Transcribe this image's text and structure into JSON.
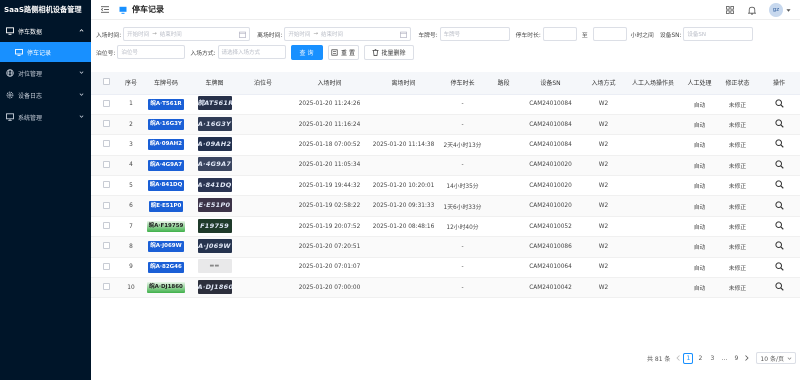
{
  "sidebar": {
    "brand": "SaaS路侧相机设备管理",
    "groups": [
      {
        "label": "停车数据",
        "icon": "monitor-icon",
        "open": true
      },
      {
        "label": "对位管理",
        "icon": "globe-icon"
      },
      {
        "label": "设备日志",
        "icon": "settings-icon"
      },
      {
        "label": "系统管理",
        "icon": "computer-icon"
      }
    ],
    "active_item": {
      "label": "停车记录",
      "icon": "monitor-icon"
    }
  },
  "header": {
    "title": "停车记录",
    "avatar_text": "gz"
  },
  "filters": {
    "entry_time_label": "入场时间:",
    "exit_time_label": "离场时间:",
    "start_placeholder": "开始时间",
    "end_placeholder": "结束时间",
    "plate_label": "车牌号:",
    "plate_placeholder": "车牌号",
    "duration_label": "停车时长:",
    "duration_to": "至",
    "duration_unit": "小时之间",
    "sn_label": "设备SN:",
    "sn_placeholder": "设备SN",
    "berth_label": "泊位号:",
    "berth_placeholder": "泊位号",
    "entry_mode_label": "入场方式:",
    "entry_mode_placeholder": "请选择入场方式",
    "search_button": "查 询",
    "reset_button": "重 置",
    "batch_delete_button": "批量删除"
  },
  "table": {
    "columns": [
      "序号",
      "车牌号码",
      "车牌图",
      "泊位号",
      "入场时间",
      "离场时间",
      "停车时长",
      "路段",
      "设备SN",
      "入场方式",
      "人工入场操作员",
      "人工处理",
      "修正状态",
      "操作"
    ],
    "rows": [
      {
        "no": "1",
        "plate": "皖A·T561R",
        "plate_color": "blue",
        "img_text": "皖AT561R",
        "berth": "",
        "entry": "2025-01-20 11:24:26",
        "exit": "",
        "duration": "-",
        "road": "",
        "sn": "CAM24010084",
        "mode": "W2",
        "operator": "",
        "manual": "自动",
        "fix": "未修正"
      },
      {
        "no": "2",
        "plate": "皖A·16G3Y",
        "plate_color": "blue",
        "img_text": "A·16G3Y",
        "berth": "",
        "entry": "2025-01-20 11:16:24",
        "exit": "",
        "duration": "-",
        "road": "",
        "sn": "CAM24010084",
        "mode": "W2",
        "operator": "",
        "manual": "自动",
        "fix": "未修正"
      },
      {
        "no": "3",
        "plate": "皖A·09AH2",
        "plate_color": "blue",
        "img_text": "A·09AH2",
        "berth": "",
        "entry": "2025-01-18 07:00:52",
        "exit": "2025-01-20 11:14:38",
        "duration": "2天4小时13分",
        "road": "",
        "sn": "CAM24010084",
        "mode": "W2",
        "operator": "",
        "manual": "自动",
        "fix": "未修正"
      },
      {
        "no": "4",
        "plate": "皖A·4G9A7",
        "plate_color": "blue",
        "img_text": "A·4G9A7",
        "berth": "",
        "entry": "2025-01-20 11:05:34",
        "exit": "",
        "duration": "-",
        "road": "",
        "sn": "CAM24010020",
        "mode": "W2",
        "operator": "",
        "manual": "自动",
        "fix": "未修正"
      },
      {
        "no": "5",
        "plate": "皖A·841DQ",
        "plate_color": "blue",
        "img_text": "A·841DQ",
        "berth": "",
        "entry": "2025-01-19 19:44:32",
        "exit": "2025-01-20 10:20:01",
        "duration": "14小时35分",
        "road": "",
        "sn": "CAM24010020",
        "mode": "W2",
        "operator": "",
        "manual": "自动",
        "fix": "未修正"
      },
      {
        "no": "6",
        "plate": "皖E·E51P0",
        "plate_color": "blue",
        "img_text": "E·E51P0",
        "berth": "",
        "entry": "2025-01-19 02:58:22",
        "exit": "2025-01-20 09:31:33",
        "duration": "1天6小时33分",
        "road": "",
        "sn": "CAM24010020",
        "mode": "W2",
        "operator": "",
        "manual": "自动",
        "fix": "未修正"
      },
      {
        "no": "7",
        "plate": "皖A·F19759",
        "plate_color": "green",
        "img_text": "F19759",
        "berth": "",
        "entry": "2025-01-19 20:07:52",
        "exit": "2025-01-20 08:48:16",
        "duration": "12小时40分",
        "road": "",
        "sn": "CAM24010052",
        "mode": "W2",
        "operator": "",
        "manual": "自动",
        "fix": "未修正"
      },
      {
        "no": "8",
        "plate": "皖A·J069W",
        "plate_color": "blue",
        "img_text": "A·J069W",
        "berth": "",
        "entry": "2025-01-20 07:20:51",
        "exit": "",
        "duration": "-",
        "road": "",
        "sn": "CAM24010086",
        "mode": "W2",
        "operator": "",
        "manual": "自动",
        "fix": "未修正"
      },
      {
        "no": "9",
        "plate": "皖A·82G46",
        "plate_color": "blue",
        "img_text": "▬▬",
        "berth": "",
        "entry": "2025-01-20 07:01:07",
        "exit": "",
        "duration": "-",
        "road": "",
        "sn": "CAM24010064",
        "mode": "W2",
        "operator": "",
        "manual": "自动",
        "fix": "未修正"
      },
      {
        "no": "10",
        "plate": "皖A·DJ1860",
        "plate_color": "green",
        "img_text": "A·DJ1860",
        "berth": "",
        "entry": "2025-01-20 07:00:00",
        "exit": "",
        "duration": "-",
        "road": "",
        "sn": "CAM24010042",
        "mode": "W2",
        "operator": "",
        "manual": "自动",
        "fix": "未修正"
      }
    ]
  },
  "pagination": {
    "total": "共 81 条",
    "pages": [
      "1",
      "2",
      "3",
      "...",
      "9"
    ],
    "current": "1",
    "page_size": "10 条/页"
  },
  "colors": {
    "sidebar_bg": "#001529",
    "accent": "#1890ff",
    "plate_blue": "#1a5fd6",
    "plate_green": "#3fb04a"
  }
}
